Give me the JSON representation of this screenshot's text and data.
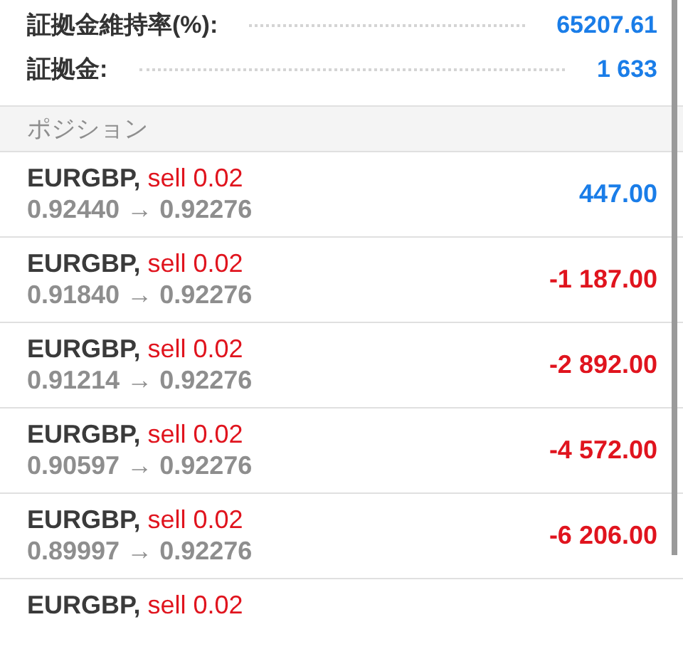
{
  "summary": [
    {
      "label": "証拠金維持率(%):",
      "value": "65207.61"
    },
    {
      "label": "証拠金:",
      "value": "1 633"
    }
  ],
  "section": {
    "title": "ポジション"
  },
  "positions": [
    {
      "symbol": "EURGBP,",
      "order": "sell 0.02",
      "prices": "0.92440 → 0.92276",
      "profit": "447.00",
      "kind": "gain"
    },
    {
      "symbol": "EURGBP,",
      "order": "sell 0.02",
      "prices": "0.91840 → 0.92276",
      "profit": "-1 187.00",
      "kind": "loss"
    },
    {
      "symbol": "EURGBP,",
      "order": "sell 0.02",
      "prices": "0.91214 → 0.92276",
      "profit": "-2 892.00",
      "kind": "loss"
    },
    {
      "symbol": "EURGBP,",
      "order": "sell 0.02",
      "prices": "0.90597 → 0.92276",
      "profit": "-4 572.00",
      "kind": "loss"
    },
    {
      "symbol": "EURGBP,",
      "order": "sell 0.02",
      "prices": "0.89997 → 0.92276",
      "profit": "-6 206.00",
      "kind": "loss"
    },
    {
      "symbol": "EURGBP,",
      "order": "sell 0.02"
    }
  ]
}
